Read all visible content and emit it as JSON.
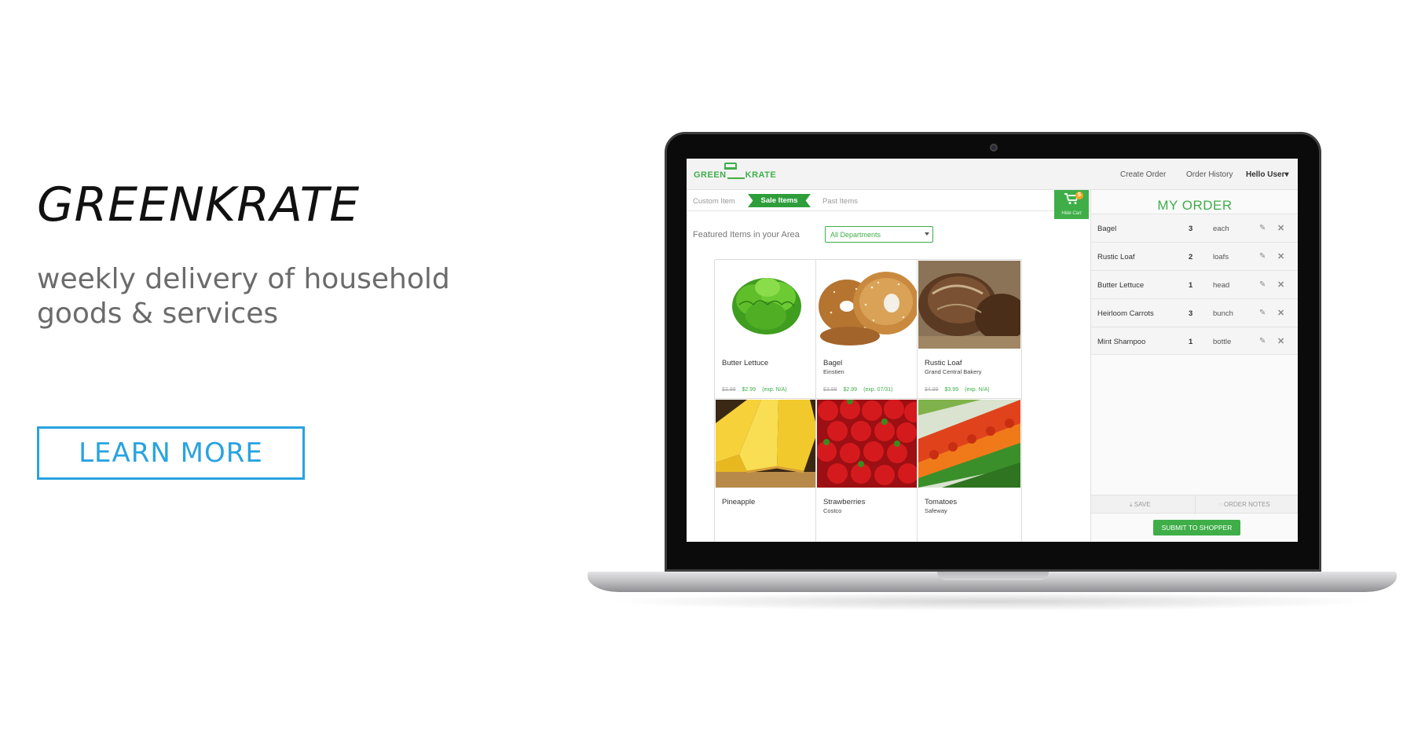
{
  "promo": {
    "brand": "GREENKRATE",
    "tagline_line1": "weekly delivery of household",
    "tagline_line2": "goods & services",
    "cta_label": "LEARN MORE"
  },
  "app": {
    "logo_left": "GREEN",
    "logo_right": "KRATE",
    "nav": {
      "create_order": "Create Order",
      "order_history": "Order History",
      "user": "Hello User▾"
    },
    "tabs": {
      "custom": "Custom Item",
      "sale": "Sale Items",
      "past": "Past Items"
    },
    "cart": {
      "badge": "5",
      "label": "Hide Cart",
      "icon": "shopping-cart-icon"
    },
    "featured_label": "Featured Items in your Area",
    "department": {
      "selected": "All Departments"
    },
    "products": [
      {
        "name": "Butter Lettuce",
        "store": "",
        "old_price": "$3.99",
        "price": "$2.99",
        "exp": "(exp. N/A)"
      },
      {
        "name": "Bagel",
        "store": "Einstien",
        "old_price": "$3.99",
        "price": "$2.99",
        "exp": "(exp. 07/31)"
      },
      {
        "name": "Rustic Loaf",
        "store": "Grand Central Bakery",
        "old_price": "$4.99",
        "price": "$3.99",
        "exp": "(exp. N/A)"
      },
      {
        "name": "Pineapple",
        "store": ""
      },
      {
        "name": "Strawberries",
        "store": "Costco"
      },
      {
        "name": "Tomatoes",
        "store": "Safeway"
      }
    ],
    "order": {
      "title": "MY ORDER",
      "items": [
        {
          "name": "Bagel",
          "qty": "3",
          "unit": "each"
        },
        {
          "name": "Rustic Loaf",
          "qty": "2",
          "unit": "loafs"
        },
        {
          "name": "Butter Lettuce",
          "qty": "1",
          "unit": "head"
        },
        {
          "name": "Heirloom Carrots",
          "qty": "3",
          "unit": "bunch"
        },
        {
          "name": "Mint Shampoo",
          "qty": "1",
          "unit": "bottle"
        }
      ],
      "save_label": "SAVE",
      "notes_label": "ORDER NOTES",
      "submit_label": "SUBMIT TO SHOPPER"
    }
  },
  "colors": {
    "brand_green": "#3fae49",
    "cta_blue": "#29a3e0"
  }
}
